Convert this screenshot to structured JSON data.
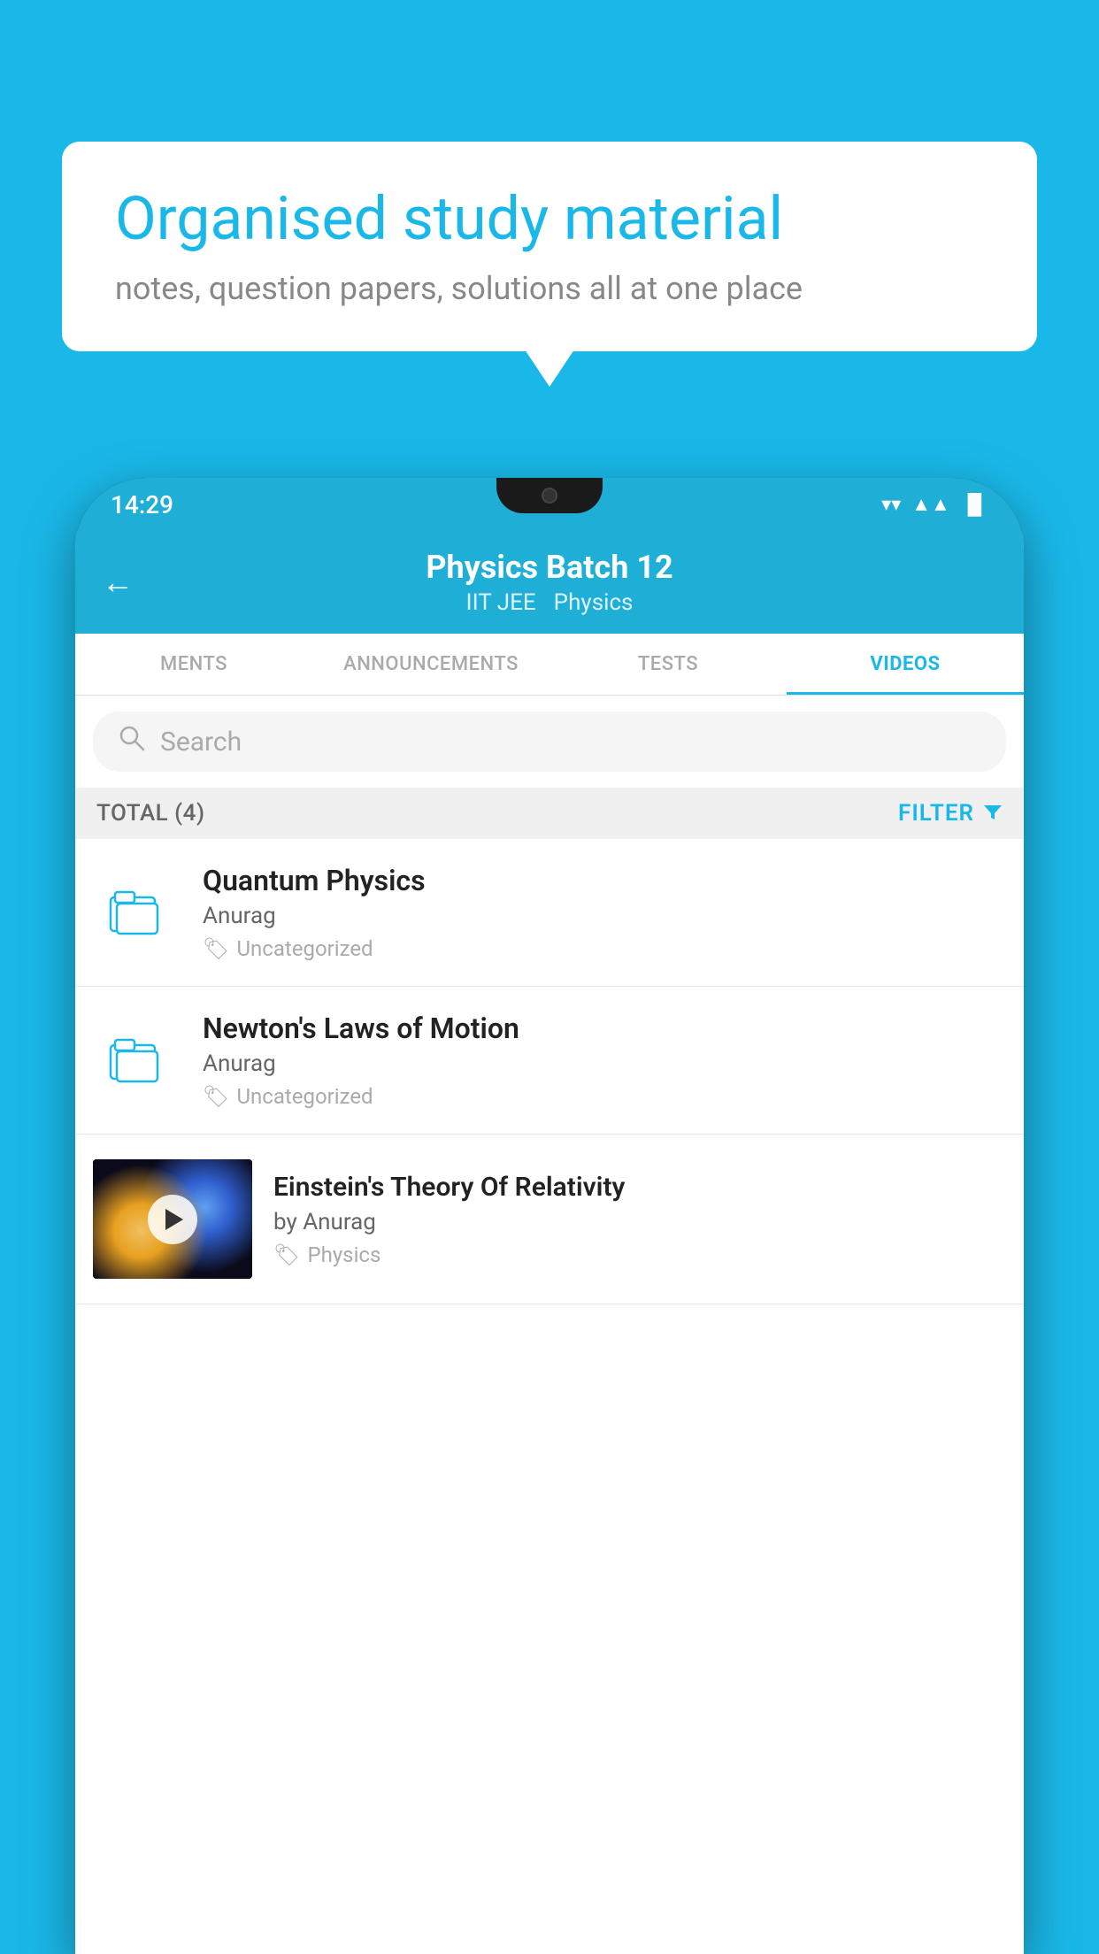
{
  "background_color": "#1ab8e8",
  "speech_bubble": {
    "headline": "Organised study material",
    "subtext": "notes, question papers, solutions all at one place"
  },
  "status_bar": {
    "time": "14:29",
    "wifi": "▼",
    "signal": "▲",
    "battery": "▐"
  },
  "app_header": {
    "back_label": "←",
    "title": "Physics Batch 12",
    "subtitle1": "IIT JEE",
    "subtitle2": "Physics"
  },
  "tabs": [
    {
      "label": "MENTS",
      "active": false
    },
    {
      "label": "ANNOUNCEMENTS",
      "active": false
    },
    {
      "label": "TESTS",
      "active": false
    },
    {
      "label": "VIDEOS",
      "active": true
    }
  ],
  "search": {
    "placeholder": "Search"
  },
  "filter_bar": {
    "total_label": "TOTAL (4)",
    "filter_label": "FILTER"
  },
  "videos": [
    {
      "title": "Quantum Physics",
      "author": "Anurag",
      "tag": "Uncategorized",
      "has_thumbnail": false
    },
    {
      "title": "Newton's Laws of Motion",
      "author": "Anurag",
      "tag": "Uncategorized",
      "has_thumbnail": false
    },
    {
      "title": "Einstein's Theory Of Relativity",
      "author": "by Anurag",
      "tag": "Physics",
      "has_thumbnail": true
    }
  ]
}
